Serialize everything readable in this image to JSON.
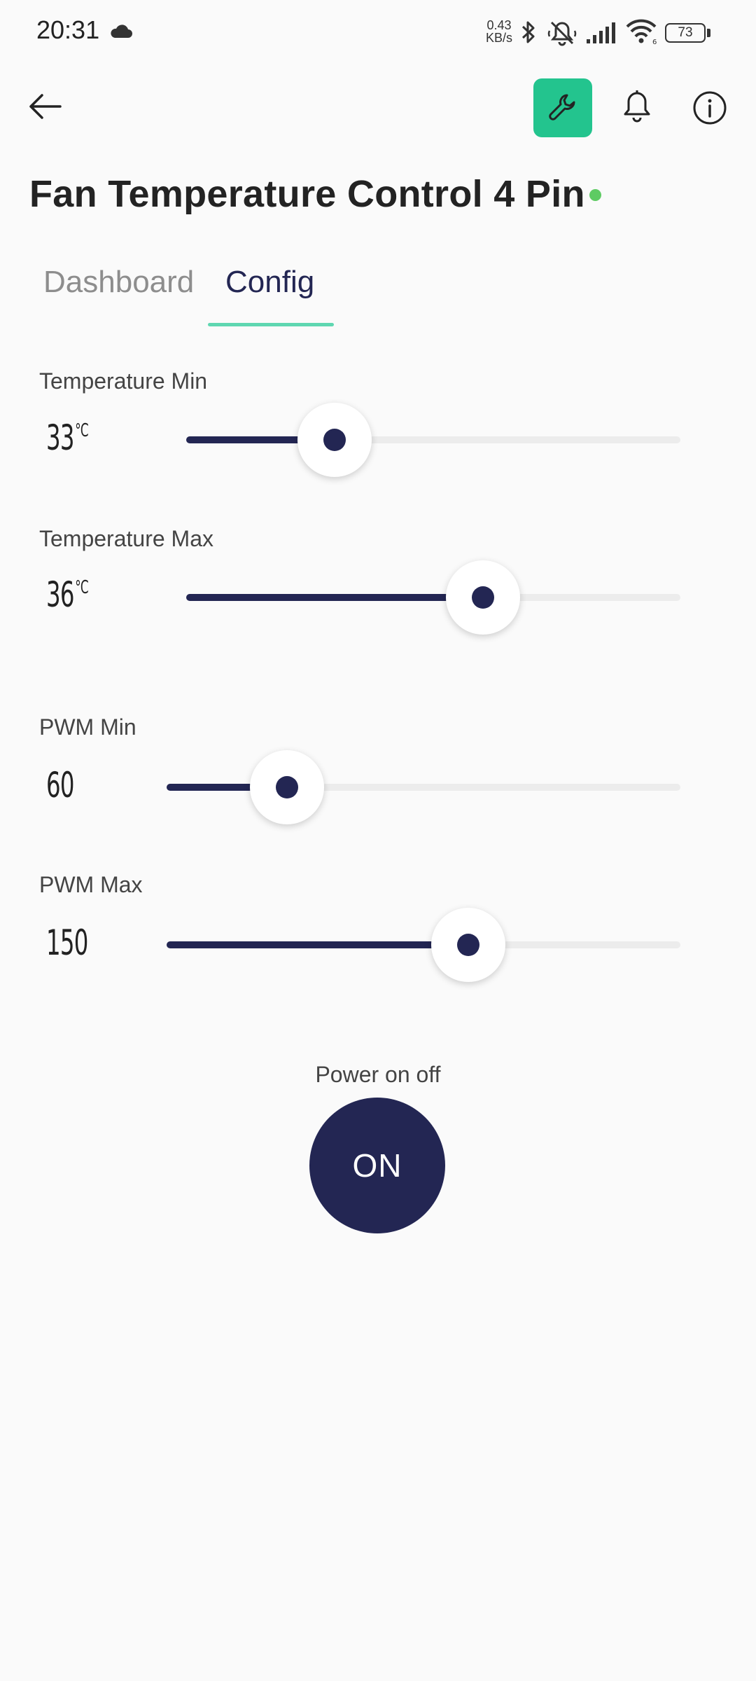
{
  "status_bar": {
    "time": "20:31",
    "net_speed_value": "0.43",
    "net_speed_unit": "KB/s",
    "battery": "73",
    "icons": [
      "cloud-icon",
      "bluetooth-icon",
      "mute-icon",
      "signal-icon",
      "wifi-icon",
      "battery-icon"
    ]
  },
  "header": {
    "title": "Fan Temperature Control 4 Pin",
    "status_color": "#5ecb63",
    "accent_color": "#23c48e",
    "icons": [
      "back-arrow-icon",
      "wrench-icon",
      "bell-icon",
      "info-icon"
    ]
  },
  "tabs": [
    {
      "label": "Dashboard",
      "active": false
    },
    {
      "label": "Config",
      "active": true
    }
  ],
  "sliders": [
    {
      "label": "Temperature Min",
      "value": "33",
      "unit": "°C",
      "fraction": 0.3
    },
    {
      "label": "Temperature Max",
      "value": "36",
      "unit": "°C",
      "fraction": 0.6
    },
    {
      "label": "PWM Min",
      "value": "60",
      "unit": "",
      "fraction": 0.235
    },
    {
      "label": "PWM Max",
      "value": "150",
      "unit": "",
      "fraction": 0.587
    }
  ],
  "power": {
    "label": "Power on off",
    "button_label": "ON",
    "button_color": "#232653"
  }
}
